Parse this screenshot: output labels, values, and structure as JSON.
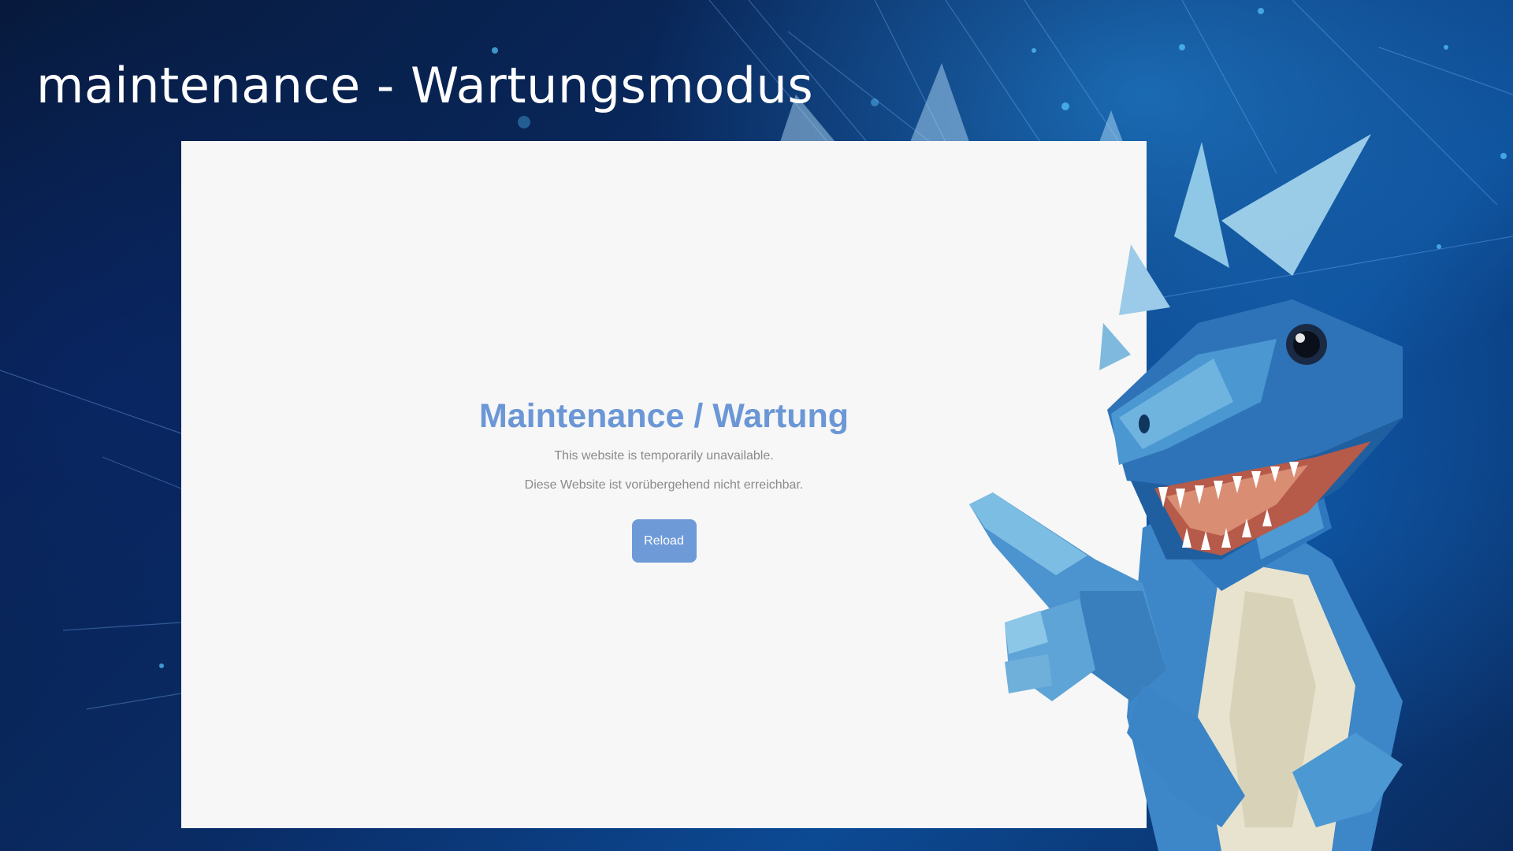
{
  "page": {
    "title": "maintenance - Wartungsmodus"
  },
  "maintenance": {
    "heading": "Maintenance / Wartung",
    "message_en": "This website is temporarily unavailable.",
    "message_de": "Diese Website ist vorübergehend nicht erreichbar.",
    "reload_label": "Reload"
  },
  "colors": {
    "accent": "#6b97d6",
    "button": "#6e9bd8",
    "panel": "#f7f7f7",
    "background": "#0a2c66"
  },
  "icons": {
    "mascot": "dinosaur-illustration"
  }
}
